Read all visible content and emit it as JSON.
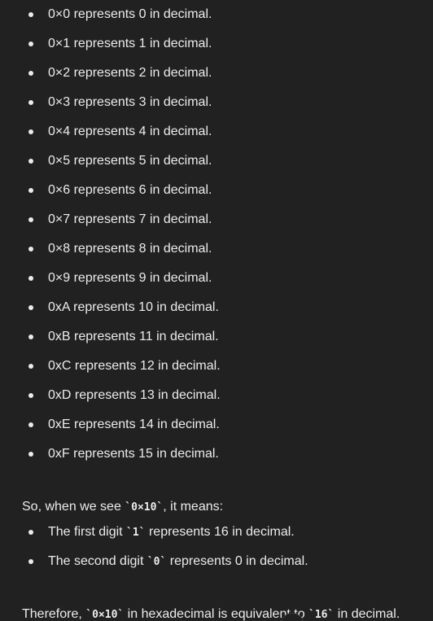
{
  "hex_list": [
    "0×0 represents 0 in decimal.",
    "0×1 represents 1 in decimal.",
    "0×2 represents 2 in decimal.",
    "0×3 represents 3 in decimal.",
    "0×4 represents 4 in decimal.",
    "0×5 represents 5 in decimal.",
    "0×6 represents 6 in decimal.",
    "0×7 represents 7 in decimal.",
    "0×8 represents 8 in decimal.",
    "0×9 represents 9 in decimal.",
    "0xA represents 10 in decimal.",
    "0xB represents 11 in decimal.",
    "0xC represents 12 in decimal.",
    "0xD represents 13 in decimal.",
    "0xE represents 14 in decimal.",
    "0xF represents 15 in decimal."
  ],
  "para1": {
    "before": "So, when we see ",
    "code": "`0×10`",
    "after": ", it means:"
  },
  "digits": [
    {
      "before": "The first digit ",
      "code": "`1`",
      "after": " represents 16 in decimal."
    },
    {
      "before": "The second digit ",
      "code": "`0`",
      "after": " represents 0 in decimal."
    }
  ],
  "para2": {
    "t1": "Therefore, ",
    "c1": "`0×10`",
    "t2": " in hexadecimal is equivalent to ",
    "c2": "`16`",
    "t3": " in decimal."
  }
}
